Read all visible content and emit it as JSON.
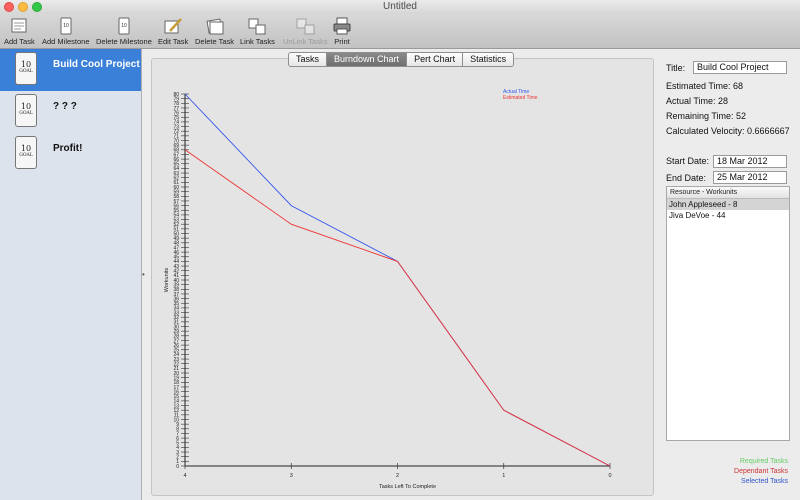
{
  "window": {
    "title": "Untitled"
  },
  "toolbar": [
    {
      "label": "Add Task",
      "icon": "add-task-icon",
      "enabled": true
    },
    {
      "label": "Add Milestone",
      "icon": "add-milestone-icon",
      "enabled": true
    },
    {
      "label": "Delete Milestone",
      "icon": "delete-milestone-icon",
      "enabled": true
    },
    {
      "label": "Edit Task",
      "icon": "edit-task-icon",
      "enabled": true
    },
    {
      "label": "Delete Task",
      "icon": "delete-task-icon",
      "enabled": true
    },
    {
      "label": "Link Tasks",
      "icon": "link-tasks-icon",
      "enabled": true
    },
    {
      "label": "UnLink Tasks",
      "icon": "unlink-tasks-icon",
      "enabled": false
    },
    {
      "label": "Print",
      "icon": "printer-icon",
      "enabled": true
    }
  ],
  "sidebar": {
    "milestones": [
      {
        "label": "Build Cool Project",
        "icon_text": "10",
        "icon_sub": "GOAL",
        "selected": true
      },
      {
        "label": "? ? ?",
        "icon_text": "10",
        "icon_sub": "GOAL",
        "selected": false
      },
      {
        "label": "Profit!",
        "icon_text": "10",
        "icon_sub": "GOAL",
        "selected": false
      }
    ]
  },
  "tabs": [
    {
      "label": "Tasks",
      "active": false
    },
    {
      "label": "Burndown Chart",
      "active": true
    },
    {
      "label": "Pert Chart",
      "active": false
    },
    {
      "label": "Statistics",
      "active": false
    }
  ],
  "chart_data": {
    "type": "line",
    "xlabel": "Tasks Left To Complete",
    "ylabel": "Workunits",
    "x": [
      4,
      3,
      2,
      1,
      0
    ],
    "x_ticks": [
      "4",
      "3",
      "2",
      "1",
      "0"
    ],
    "ylim": [
      0,
      80
    ],
    "y_tick_step": 1,
    "grid": false,
    "legend_position": "top-right",
    "series": [
      {
        "name": "Actual Time",
        "color": "#3355ee",
        "values": [
          80,
          56,
          44,
          12,
          0
        ]
      },
      {
        "name": "Estimated Time",
        "color": "#ee3333",
        "values": [
          68,
          52,
          44,
          12,
          0
        ]
      }
    ]
  },
  "details": {
    "title_label": "Title:",
    "title_value": "Build Cool Project",
    "estimated_time": "Estimated Time: 68",
    "actual_time": "Actual Time: 28",
    "remaining_time": "Remaining Time: 52",
    "velocity": "Calculated Velocity: 0.6666667",
    "start_label": "Start Date:",
    "start_value": "18 Mar 2012",
    "end_label": "End Date:",
    "end_value": "25 Mar 2012"
  },
  "resources": {
    "header": "Resource - Workunits",
    "rows": [
      {
        "text": "John Appleseed - 8",
        "selected": true
      },
      {
        "text": "Jiva DeVoe - 44",
        "selected": false
      }
    ]
  },
  "legend": {
    "required": {
      "label": "Required Tasks",
      "color": "#66cc66"
    },
    "dependant": {
      "label": "Dependant Tasks",
      "color": "#cc3333"
    },
    "selected": {
      "label": "Selected Tasks",
      "color": "#3355cc"
    }
  }
}
